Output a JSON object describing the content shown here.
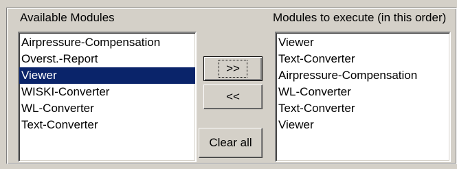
{
  "available": {
    "label": "Available Modules",
    "items": [
      "Airpressure-Compensation",
      "Overst.-Report",
      "Viewer",
      "WISKI-Converter",
      "WL-Converter",
      "Text-Converter"
    ],
    "selected_index": 2
  },
  "execute": {
    "label": "Modules to execute (in this order)",
    "items": [
      "Viewer",
      "Text-Converter",
      "Airpressure-Compensation",
      "WL-Converter",
      "Text-Converter",
      "Viewer"
    ]
  },
  "buttons": {
    "add": ">>",
    "remove": "<<",
    "clear": "Clear all"
  },
  "colors": {
    "selection": "#0a246a",
    "dialog": "#d4d0c8"
  }
}
